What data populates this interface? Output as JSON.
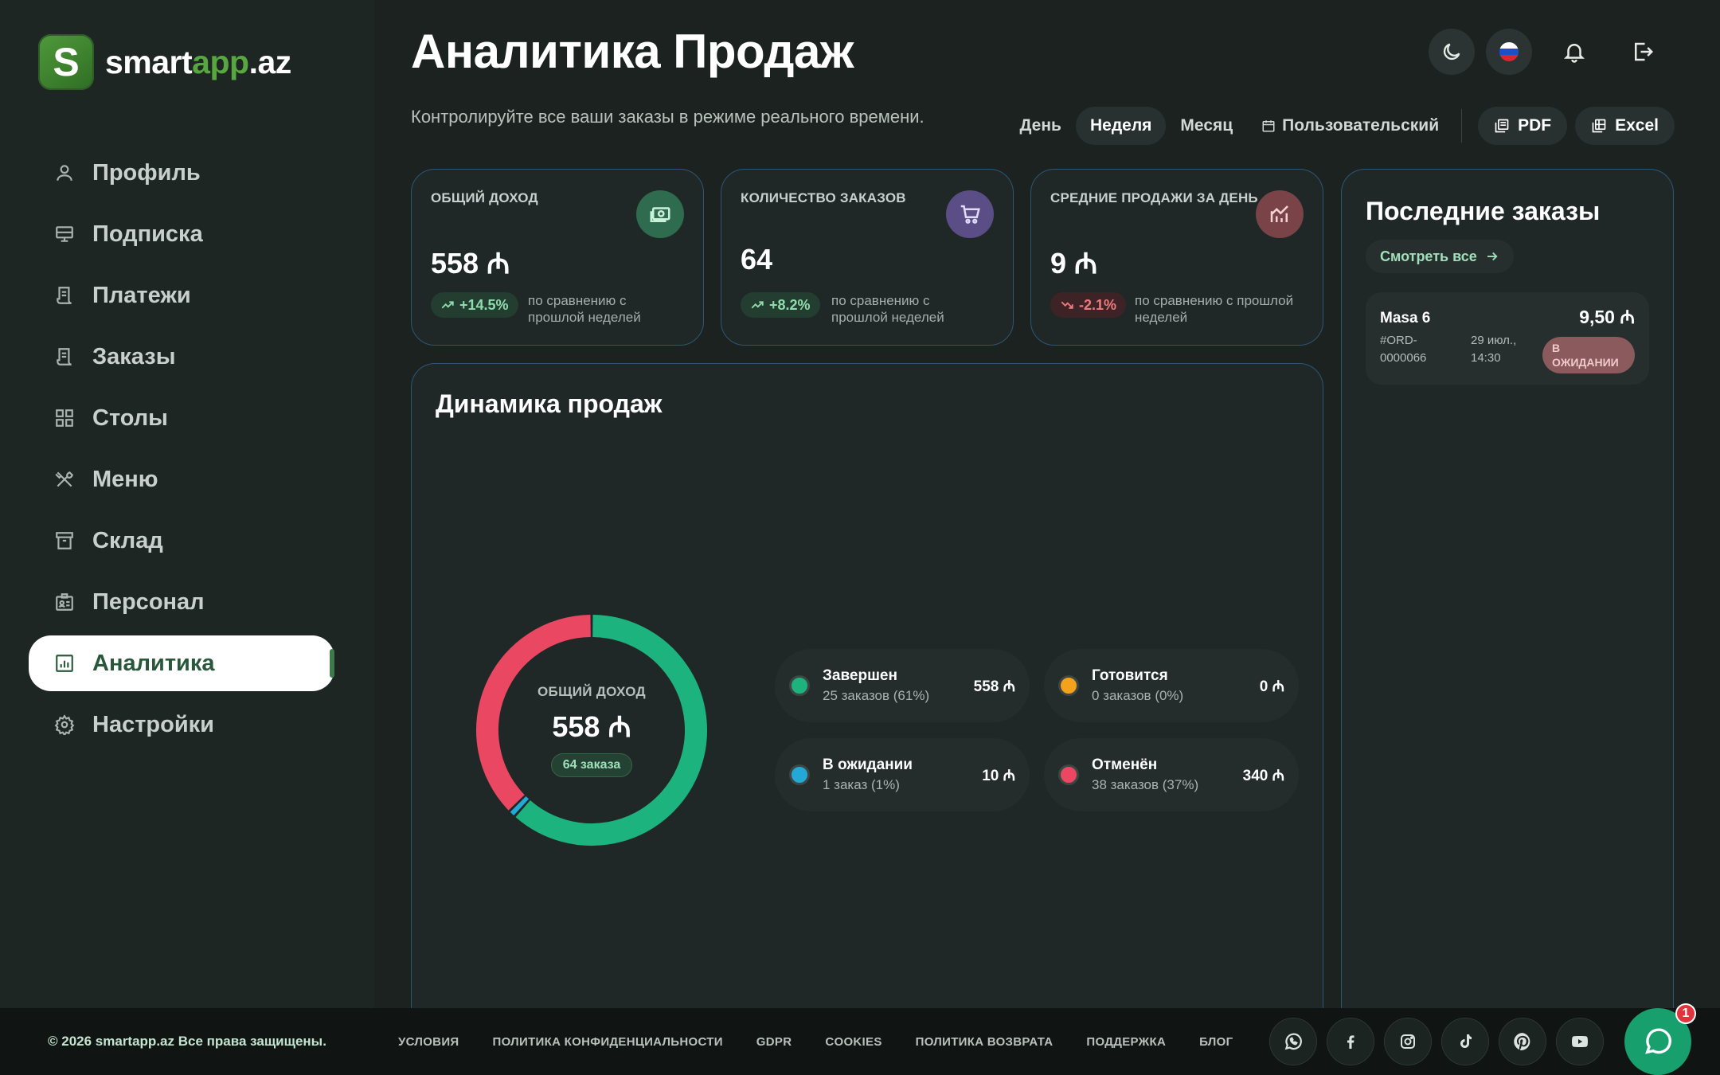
{
  "brand": {
    "logo_letter": "S",
    "name_part1": "smart",
    "name_part2": "app",
    "name_part3": ".az",
    "accent": "#58a640"
  },
  "sidebar": {
    "items": [
      {
        "label": "Профиль",
        "icon": "user-icon",
        "active": false
      },
      {
        "label": "Подписка",
        "icon": "monitor-icon",
        "active": false
      },
      {
        "label": "Платежи",
        "icon": "receipt-icon",
        "active": false
      },
      {
        "label": "Заказы",
        "icon": "receipt-icon",
        "active": false
      },
      {
        "label": "Столы",
        "icon": "grid-icon",
        "active": false
      },
      {
        "label": "Меню",
        "icon": "utensils-icon",
        "active": false
      },
      {
        "label": "Склад",
        "icon": "archive-icon",
        "active": false
      },
      {
        "label": "Персонал",
        "icon": "id-card-icon",
        "active": false
      },
      {
        "label": "Аналитика",
        "icon": "bar-chart-icon",
        "active": true
      },
      {
        "label": "Настройки",
        "icon": "gear-icon",
        "active": false
      }
    ]
  },
  "header": {
    "title": "Аналитика Продаж",
    "subtitle": "Контролируйте все ваши заказы в режиме реального времени.",
    "filters": [
      {
        "label": "День",
        "active": false
      },
      {
        "label": "Неделя",
        "active": true
      },
      {
        "label": "Месяц",
        "active": false
      },
      {
        "label": "Пользовательский",
        "active": false
      }
    ],
    "export_pdf": "PDF",
    "export_excel": "Excel"
  },
  "stats": [
    {
      "label": "ОБЩИЙ ДОХОД",
      "value": "558 ₼",
      "change": "+14.5%",
      "trend": "up",
      "compare": "по сравнению с прошлой неделей",
      "icon": "money-icon",
      "icon_bg": "#2f6b4e"
    },
    {
      "label": "КОЛИЧЕСТВО ЗАКАЗОВ",
      "value": "64",
      "change": "+8.2%",
      "trend": "up",
      "compare": "по сравнению с прошлой неделей",
      "icon": "cart-icon",
      "icon_bg": "#5b4d86"
    },
    {
      "label": "СРЕДНИЕ ПРОДАЖИ ЗА ДЕНЬ",
      "value": "9 ₼",
      "change": "-2.1%",
      "trend": "down",
      "compare": "по сравнению с прошлой неделей",
      "icon": "trend-chart-icon",
      "icon_bg": "#7a4347"
    }
  ],
  "dynamics": {
    "title": "Динамика продаж",
    "center_label": "ОБЩИЙ ДОХОД",
    "center_value": "558 ₼",
    "center_badge": "64 заказа",
    "legend": [
      {
        "name": "Завершен",
        "sub": "25 заказов (61%)",
        "amount": "558 ₼",
        "color": "#1db37e"
      },
      {
        "name": "Готовится",
        "sub": "0 заказов (0%)",
        "amount": "0 ₼",
        "color": "#f4a21b"
      },
      {
        "name": "В ожидании",
        "sub": "1 заказ (1%)",
        "amount": "10 ₼",
        "color": "#22a9d6"
      },
      {
        "name": "Отменён",
        "sub": "38 заказов (37%)",
        "amount": "340 ₼",
        "color": "#ea4762"
      }
    ]
  },
  "chart_data": {
    "type": "pie",
    "categories": [
      "Завершен",
      "Готовится",
      "В ожидании",
      "Отменён"
    ],
    "values": [
      61,
      0,
      1,
      37
    ],
    "colors": [
      "#1db37e",
      "#f4a21b",
      "#22a9d6",
      "#ea4762"
    ]
  },
  "recent": {
    "title": "Последние заказы",
    "see_all": "Смотреть все",
    "orders": [
      {
        "name": "Masa 6",
        "id": "#ORD-0000066",
        "date": "29 июл., 14:30",
        "amount": "9,50 ₼",
        "status": "В ожидании"
      }
    ]
  },
  "footer": {
    "copyright": "© 2026 smartapp.az Все права защищены.",
    "links": [
      "УСЛОВИЯ",
      "ПОЛИТИКА КОНФИДЕНЦИАЛЬНОСТИ",
      "GDPR",
      "COOKIES",
      "ПОЛИТИКА ВОЗВРАТА",
      "ПОДДЕРЖКА",
      "БЛОГ"
    ],
    "socials": [
      "whatsapp-icon",
      "facebook-icon",
      "instagram-icon",
      "tiktok-icon",
      "pinterest-icon",
      "youtube-icon"
    ],
    "chat_badge": "1"
  }
}
